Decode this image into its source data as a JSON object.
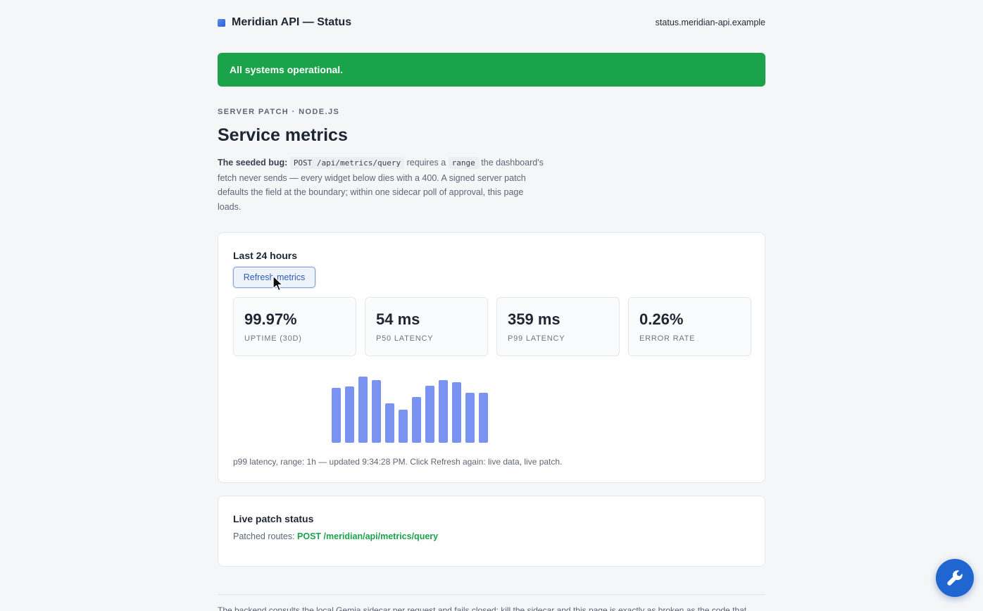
{
  "header": {
    "title": "Meridian API — Status",
    "host": "status.meridian-api.example"
  },
  "banner": {
    "text": "All systems operational."
  },
  "intro": {
    "eyebrow": "SERVER PATCH · NODE.JS",
    "title": "Service metrics",
    "bug_label": "The seeded bug:",
    "code_endpoint": "POST /api/metrics/query",
    "text_requires": " requires a ",
    "code_field": "range",
    "text_rest": " the dashboard's fetch never sends — every widget below dies with a 400. A signed server patch defaults the field at the boundary; within one sidecar poll of approval, this page loads."
  },
  "metrics_card": {
    "heading": "Last 24 hours",
    "refresh_label": "Refresh metrics",
    "stats": [
      {
        "value": "99.97%",
        "label": "UPTIME (30D)"
      },
      {
        "value": "54 ms",
        "label": "P50 LATENCY"
      },
      {
        "value": "359 ms",
        "label": "P99 LATENCY"
      },
      {
        "value": "0.26%",
        "label": "ERROR RATE"
      }
    ],
    "caption": "p99 latency, range: 1h — updated 9:34:28 PM. Click Refresh again: live data, live patch."
  },
  "chart_data": {
    "type": "bar",
    "values": [
      78,
      80,
      94,
      89,
      56,
      47,
      65,
      81,
      89,
      86,
      71,
      71
    ],
    "ylim": [
      0,
      100
    ],
    "color": "#7b93f0"
  },
  "patch_card": {
    "heading": "Live patch status",
    "label": "Patched routes: ",
    "route": "POST /meridian/api/metrics/query"
  },
  "footer": {
    "text": "The backend consults the local Gemia sidecar per request and fails closed: kill the sidecar and this page is exactly as broken as the code that"
  },
  "colors": {
    "success": "#1aa34a",
    "accent": "#1f66d1"
  },
  "icons": {
    "fab": "wrench-icon",
    "cursor": "mouse-pointer-icon"
  }
}
